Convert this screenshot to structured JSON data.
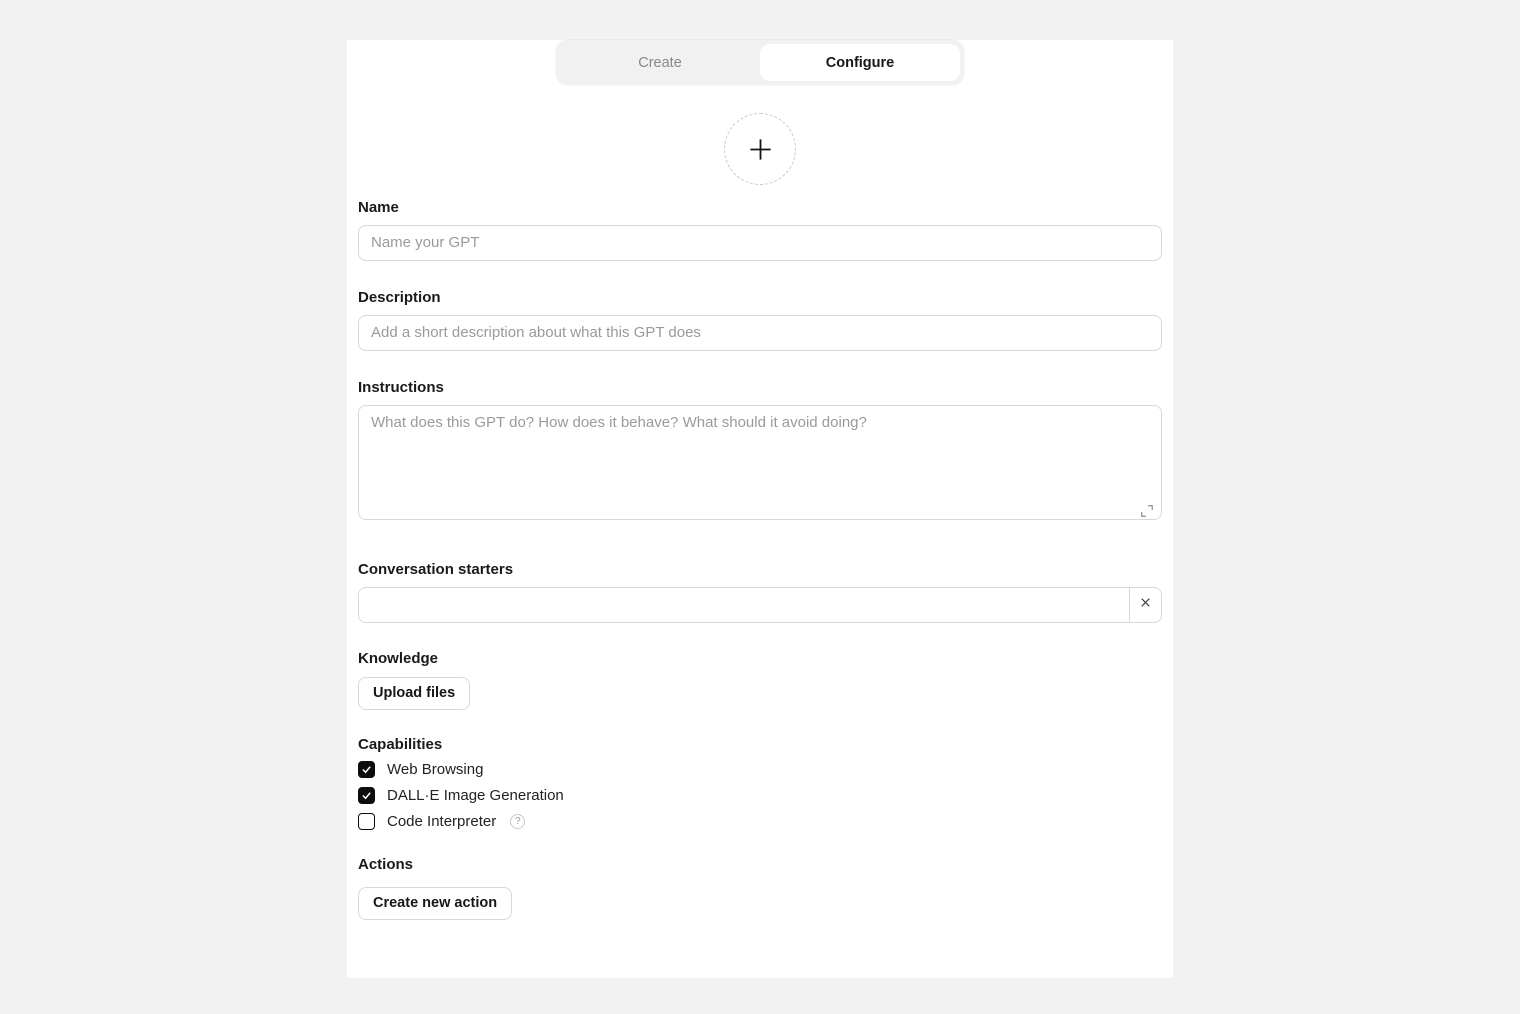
{
  "tabs": {
    "create": "Create",
    "configure": "Configure"
  },
  "name": {
    "label": "Name",
    "placeholder": "Name your GPT"
  },
  "description": {
    "label": "Description",
    "placeholder": "Add a short description about what this GPT does"
  },
  "instructions": {
    "label": "Instructions",
    "placeholder": "What does this GPT do? How does it behave? What should it avoid doing?"
  },
  "starters": {
    "label": "Conversation starters"
  },
  "knowledge": {
    "label": "Knowledge",
    "upload_label": "Upload files"
  },
  "capabilities": {
    "label": "Capabilities",
    "items": [
      {
        "label": "Web Browsing",
        "checked": true,
        "help": false
      },
      {
        "label": "DALL·E Image Generation",
        "checked": true,
        "help": false
      },
      {
        "label": "Code Interpreter",
        "checked": false,
        "help": true
      }
    ]
  },
  "actions": {
    "label": "Actions",
    "create_label": "Create new action"
  }
}
